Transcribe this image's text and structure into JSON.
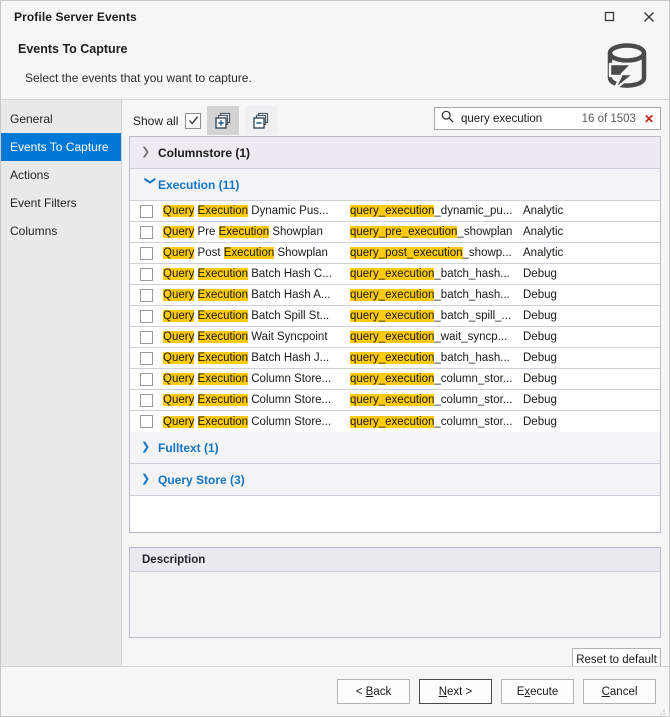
{
  "window": {
    "title": "Profile Server Events",
    "maximize_icon": "maximize-icon",
    "close_icon": "close-icon"
  },
  "header": {
    "title": "Events To Capture",
    "subtitle": "Select the events that you want to capture.",
    "logo_icon": "database-lightning-icon"
  },
  "sidebar": {
    "items": [
      {
        "label": "General",
        "active": false
      },
      {
        "label": "Events To Capture",
        "active": true
      },
      {
        "label": "Actions",
        "active": false
      },
      {
        "label": "Event Filters",
        "active": false
      },
      {
        "label": "Columns",
        "active": false
      }
    ]
  },
  "toolbar": {
    "show_all_label": "Show all",
    "show_all_checked": true,
    "expand_all_icon": "expand-all-icon",
    "collapse_all_icon": "collapse-all-icon"
  },
  "search": {
    "icon": "search-icon",
    "value": "query execution",
    "placeholder": "Search",
    "count": "16 of 1503",
    "clear_label": "✕"
  },
  "grid": {
    "groups": [
      {
        "name": "Columnstore (1)",
        "expanded": false,
        "style": "hover"
      },
      {
        "name": "Execution (11)",
        "expanded": true,
        "style": "plain"
      },
      {
        "name": "Fulltext (1)",
        "expanded": false,
        "style": "plain"
      },
      {
        "name": "Query Store (3)",
        "expanded": false,
        "style": "plain"
      }
    ],
    "rows": [
      {
        "checked": false,
        "name_parts": [
          [
            "Query",
            1
          ],
          [
            " ",
            0
          ],
          [
            "Execution",
            1
          ],
          [
            " Dynamic Pus...",
            0
          ]
        ],
        "pkg_parts": [
          [
            "query_execution",
            1
          ],
          [
            "_dynamic_pu...",
            0
          ]
        ],
        "channel": "Analytic"
      },
      {
        "checked": false,
        "name_parts": [
          [
            "Query",
            1
          ],
          [
            " Pre ",
            0
          ],
          [
            "Execution",
            1
          ],
          [
            " Showplan",
            0
          ]
        ],
        "pkg_parts": [
          [
            "query_pre_execution",
            1
          ],
          [
            "_showplan",
            0
          ]
        ],
        "channel": "Analytic"
      },
      {
        "checked": false,
        "name_parts": [
          [
            "Query",
            1
          ],
          [
            " Post ",
            0
          ],
          [
            "Execution",
            1
          ],
          [
            " Showplan",
            0
          ]
        ],
        "pkg_parts": [
          [
            "query_post_execution",
            1
          ],
          [
            "_showp...",
            0
          ]
        ],
        "channel": "Analytic"
      },
      {
        "checked": false,
        "name_parts": [
          [
            "Query",
            1
          ],
          [
            " ",
            0
          ],
          [
            "Execution",
            1
          ],
          [
            " Batch Hash C...",
            0
          ]
        ],
        "pkg_parts": [
          [
            "query_execution",
            1
          ],
          [
            "_batch_hash...",
            0
          ]
        ],
        "channel": "Debug"
      },
      {
        "checked": false,
        "name_parts": [
          [
            "Query",
            1
          ],
          [
            " ",
            0
          ],
          [
            "Execution",
            1
          ],
          [
            " Batch Hash A...",
            0
          ]
        ],
        "pkg_parts": [
          [
            "query_execution",
            1
          ],
          [
            "_batch_hash...",
            0
          ]
        ],
        "channel": "Debug"
      },
      {
        "checked": false,
        "name_parts": [
          [
            "Query",
            1
          ],
          [
            " ",
            0
          ],
          [
            "Execution",
            1
          ],
          [
            " Batch Spill St...",
            0
          ]
        ],
        "pkg_parts": [
          [
            "query_execution",
            1
          ],
          [
            "_batch_spill_...",
            0
          ]
        ],
        "channel": "Debug"
      },
      {
        "checked": false,
        "name_parts": [
          [
            "Query",
            1
          ],
          [
            " ",
            0
          ],
          [
            "Execution",
            1
          ],
          [
            " Wait Syncpoint",
            0
          ]
        ],
        "pkg_parts": [
          [
            "query_execution",
            1
          ],
          [
            "_wait_syncp...",
            0
          ]
        ],
        "channel": "Debug"
      },
      {
        "checked": false,
        "name_parts": [
          [
            "Query",
            1
          ],
          [
            " ",
            0
          ],
          [
            "Execution",
            1
          ],
          [
            " Batch Hash J...",
            0
          ]
        ],
        "pkg_parts": [
          [
            "query_execution",
            1
          ],
          [
            "_batch_hash...",
            0
          ]
        ],
        "channel": "Debug"
      },
      {
        "checked": false,
        "name_parts": [
          [
            "Query",
            1
          ],
          [
            " ",
            0
          ],
          [
            "Execution",
            1
          ],
          [
            " Column Store...",
            0
          ]
        ],
        "pkg_parts": [
          [
            "query_execution",
            1
          ],
          [
            "_column_stor...",
            0
          ]
        ],
        "channel": "Debug"
      },
      {
        "checked": false,
        "name_parts": [
          [
            "Query",
            1
          ],
          [
            " ",
            0
          ],
          [
            "Execution",
            1
          ],
          [
            " Column Store...",
            0
          ]
        ],
        "pkg_parts": [
          [
            "query_execution",
            1
          ],
          [
            "_column_stor...",
            0
          ]
        ],
        "channel": "Debug"
      },
      {
        "checked": false,
        "name_parts": [
          [
            "Query",
            1
          ],
          [
            " ",
            0
          ],
          [
            "Execution",
            1
          ],
          [
            " Column Store...",
            0
          ]
        ],
        "pkg_parts": [
          [
            "query_execution",
            1
          ],
          [
            "_column_stor...",
            0
          ]
        ],
        "channel": "Debug"
      }
    ]
  },
  "description": {
    "header": "Description",
    "text": ""
  },
  "buttons": {
    "reset": "Reset to default",
    "back": "< Back",
    "back_mnemonic": "B",
    "next": "Next >",
    "next_mnemonic": "N",
    "execute": "Execute",
    "execute_mnemonic": "x",
    "cancel": "Cancel",
    "cancel_mnemonic": "C"
  },
  "colors": {
    "accent": "#0078d7",
    "group_link": "#1475c4",
    "highlight": "#fdca0c",
    "clear_red": "#c01c1c"
  }
}
